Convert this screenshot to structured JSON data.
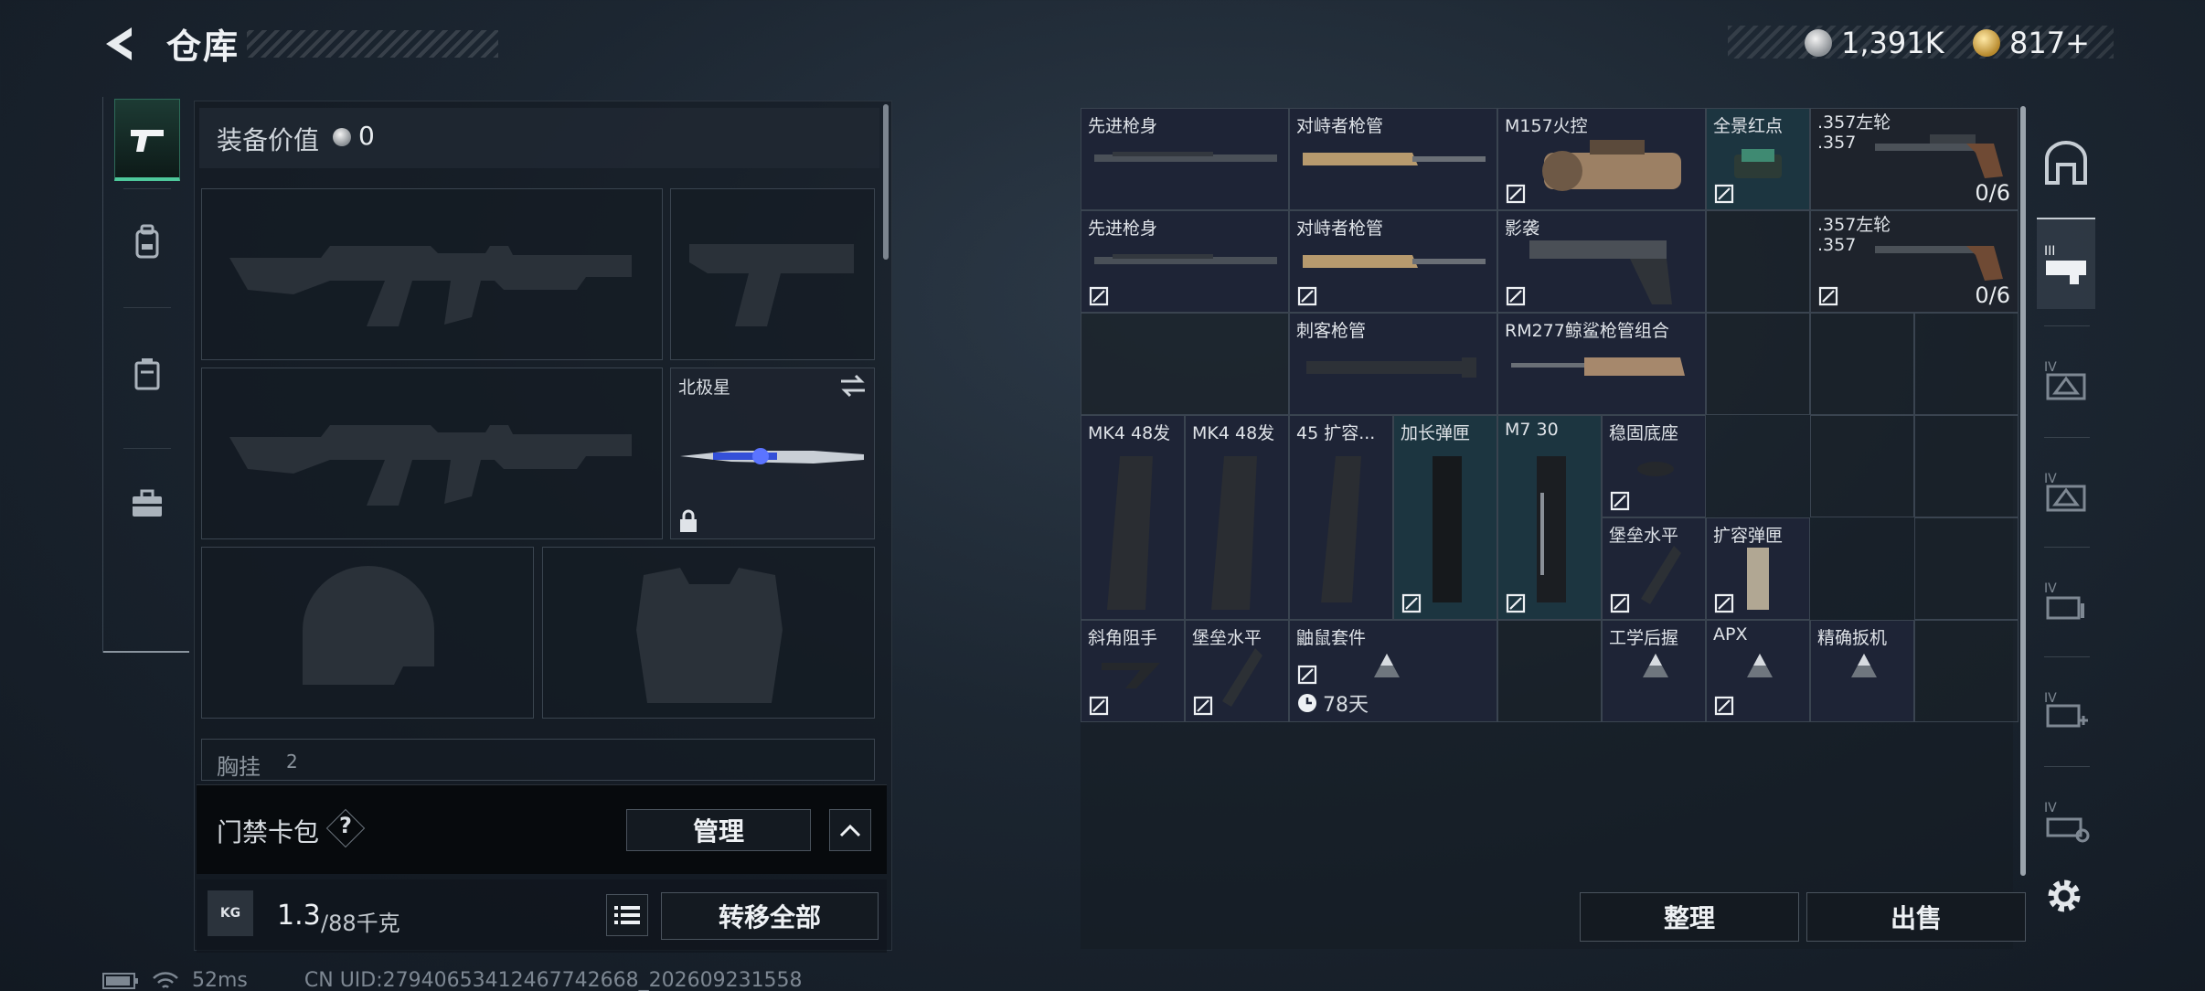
{
  "header": {
    "title": "仓库",
    "silver_amount": "1,391K",
    "gold_amount": "817+"
  },
  "left_panel": {
    "equip_value_label": "装备价值",
    "equip_value": "0",
    "melee_name": "北极星",
    "chest_label": "胸挂",
    "chest_count": "2",
    "cardpack_label": "门禁卡包",
    "cardpack_help": "?",
    "manage_label": "管理",
    "weight_value": "1.3",
    "weight_capacity": "/88千克",
    "weight_icon_text": "KG",
    "transfer_all_label": "转移全部"
  },
  "grid_items": [
    {
      "label": "先进枪身"
    },
    {
      "label": "对峙者枪管"
    },
    {
      "label": "M157火控"
    },
    {
      "label": "全景红点"
    },
    {
      "label": ".357左轮\n.357",
      "count": "0/6"
    },
    {
      "label": "先进枪身"
    },
    {
      "label": "对峙者枪管"
    },
    {
      "label": "影袭"
    },
    {
      "label": ".357左轮\n.357",
      "count": "0/6"
    },
    {
      "label": "刺客枪管"
    },
    {
      "label": "RM277鲸鲨枪管组合"
    },
    {
      "label": "MK4 48发"
    },
    {
      "label": "MK4 48发"
    },
    {
      "label": "45 扩容..."
    },
    {
      "label": "加长弹匣"
    },
    {
      "label": "M7 30"
    },
    {
      "label": "稳固底座"
    },
    {
      "label": "堡垒水平"
    },
    {
      "label": "扩容弹匣"
    },
    {
      "label": "斜角阻手"
    },
    {
      "label": "堡垒水平"
    },
    {
      "label": "鼬鼠套件",
      "timer": "78天"
    },
    {
      "label": "工学后握"
    },
    {
      "label": "APX"
    },
    {
      "label": "精确扳机"
    }
  ],
  "actions": {
    "sort_label": "整理",
    "sell_label": "出售"
  },
  "footer": {
    "ping": "52ms",
    "uid": "CN UID:27940653412467742668_202609231558"
  },
  "colors": {
    "accent_green": "#4ec89b",
    "item_bg": "#1e2436"
  }
}
